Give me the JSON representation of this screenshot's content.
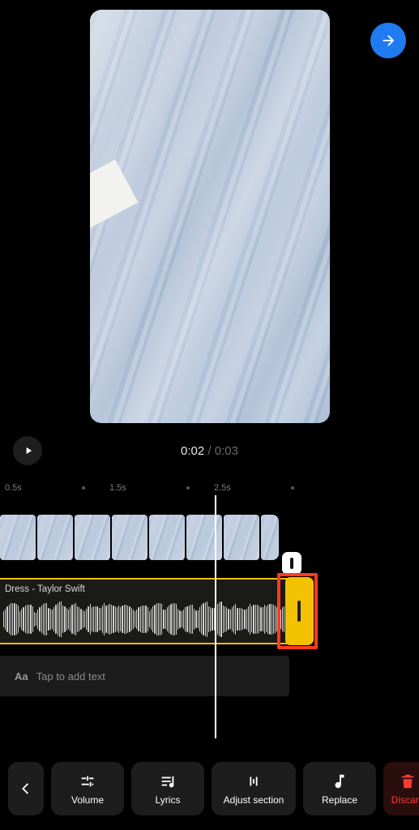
{
  "time": {
    "current": "0:02",
    "separator": " / ",
    "total": "0:03"
  },
  "ruler": {
    "t1": "0.5s",
    "t2": "1.5s",
    "t3": "2.5s"
  },
  "audio": {
    "title": "Dress - Taylor Swift"
  },
  "text_layer": {
    "icon_label": "Aa",
    "placeholder": "Tap to add text"
  },
  "toolbar": {
    "volume": "Volume",
    "lyrics": "Lyrics",
    "adjust": "Adjust section",
    "replace": "Replace",
    "discard": "Discard"
  }
}
